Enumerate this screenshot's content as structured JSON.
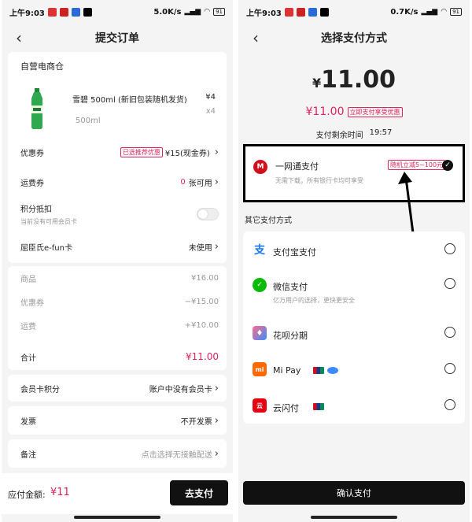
{
  "status_left": {
    "time": "上午9:03",
    "net_speed": "5.0K/s",
    "battery": "91"
  },
  "status_right": {
    "time": "上午9:03",
    "net_speed": "0.7K/s",
    "battery": "91"
  },
  "order": {
    "title": "提交订单",
    "store_name": "自营电商仓",
    "product": {
      "name": "雪碧 500ml (新旧包装随机发货)",
      "spec": "500ml",
      "price": "¥4",
      "quantity": "x4"
    },
    "coupon": {
      "label": "优惠券",
      "tag": "已选推荐优惠",
      "value": "¥15(现金券)"
    },
    "shipping_coupon": {
      "label": "运费券",
      "count": "0",
      "suffix": "张可用"
    },
    "points": {
      "label": "积分抵扣",
      "hint": "当前没有可用会员卡"
    },
    "efun_card": {
      "label": "屈臣氏e-fun卡",
      "value": "未使用"
    },
    "summary": [
      {
        "label": "商品",
        "value": "¥16.00"
      },
      {
        "label": "优惠券",
        "value": "−¥15.00"
      },
      {
        "label": "运费",
        "value": "+¥10.00"
      }
    ],
    "total": {
      "label": "合计",
      "value": "¥11.00"
    },
    "member_points": {
      "label": "会员卡积分",
      "value": "账户中没有会员卡"
    },
    "invoice": {
      "label": "发票",
      "value": "不开发票"
    },
    "remark": {
      "label": "备注",
      "value": "点击选择无接触配送"
    },
    "payable_label": "应付金额:",
    "payable_value": "¥11",
    "pay_button": "去支付"
  },
  "payment": {
    "title": "选择支付方式",
    "currency": "¥",
    "amount": "11.00",
    "sub_amount": "¥11.00",
    "promo_tag": "立即支付享受优惠",
    "countdown_label": "支付剩余时间",
    "countdown": "19:57",
    "highlight": {
      "name": "一网通支付",
      "tag": "随机立减5~100元",
      "desc": "无需下载，所有银行卡均可享受"
    },
    "other_header": "其它支付方式",
    "methods": [
      {
        "name": "支付宝支付",
        "icon": "alipay-icon",
        "desc": ""
      },
      {
        "name": "微信支付",
        "icon": "wechat-pay-icon",
        "desc": "亿万用户的选择，更快更安全"
      },
      {
        "name": "花呗分期",
        "icon": "huabei-icon",
        "desc": ""
      },
      {
        "name": "Mi Pay",
        "icon": "mi-pay-icon",
        "desc": ""
      },
      {
        "name": "云闪付",
        "icon": "unionpay-quickpass-icon",
        "desc": ""
      }
    ],
    "confirm_button": "确认支付"
  },
  "colors": {
    "accent": "#e0245e",
    "primary_button": "#111111"
  }
}
